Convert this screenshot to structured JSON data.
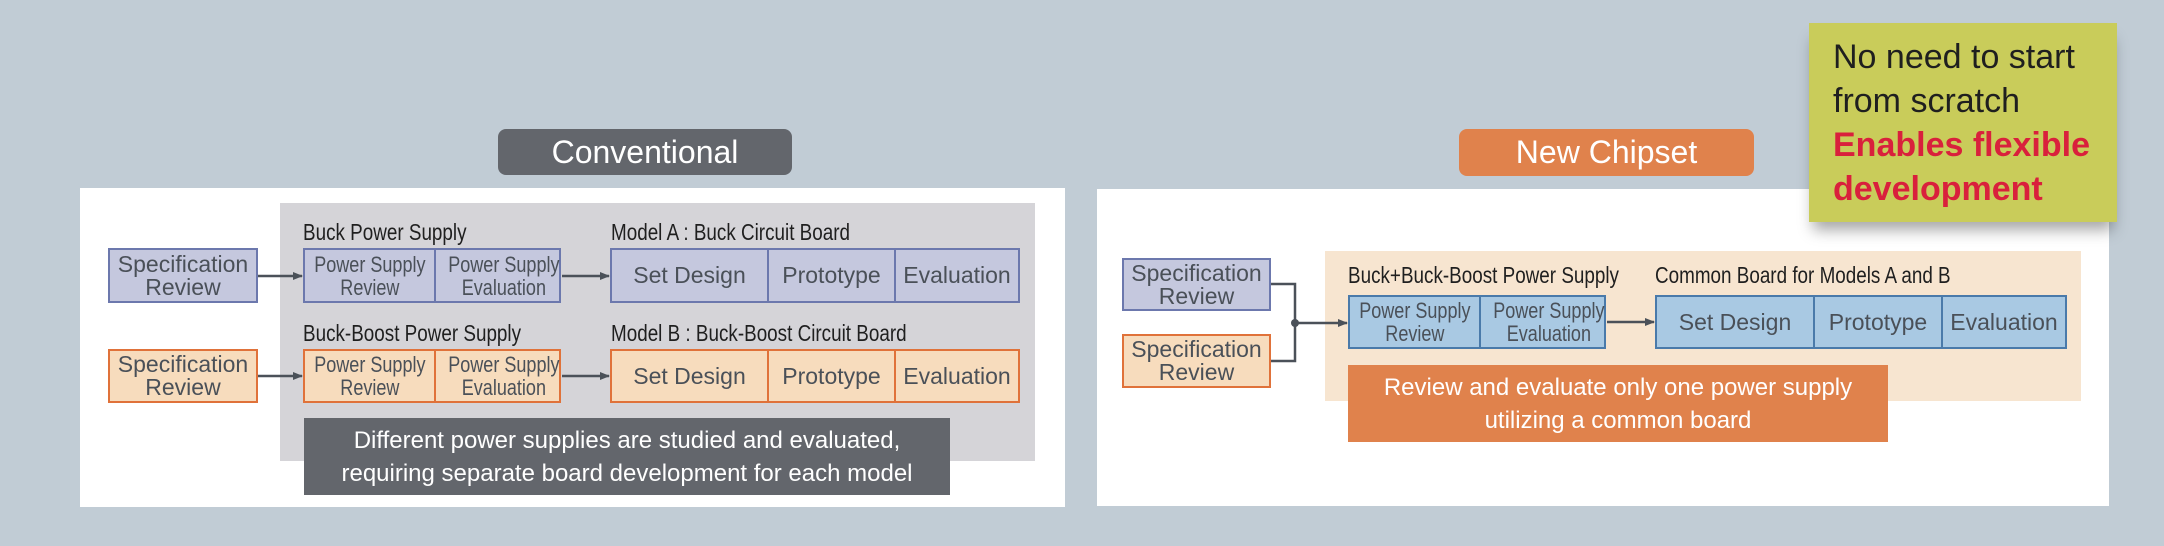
{
  "conventional": {
    "title": "Conventional",
    "rows": [
      {
        "spec": [
          "Specification",
          "Review"
        ],
        "ps_label": "Buck Power Supply",
        "ps_cells": [
          [
            "Power Supply",
            "Review"
          ],
          [
            "Power Supply",
            "Evaluation"
          ]
        ],
        "board_label": "Model A : Buck Circuit Board",
        "board_cells": [
          "Set Design",
          "Prototype",
          "Evaluation"
        ]
      },
      {
        "spec": [
          "Specification",
          "Review"
        ],
        "ps_label": "Buck-Boost Power Supply",
        "ps_cells": [
          [
            "Power Supply",
            "Review"
          ],
          [
            "Power Supply",
            "Evaluation"
          ]
        ],
        "board_label": "Model B : Buck-Boost Circuit Board",
        "board_cells": [
          "Set Design",
          "Prototype",
          "Evaluation"
        ]
      }
    ],
    "note": [
      "Different power supplies are studied and evaluated,",
      "requiring separate board development for each model"
    ]
  },
  "new_chipset": {
    "title": "New Chipset",
    "specs": [
      [
        "Specification",
        "Review"
      ],
      [
        "Specification",
        "Review"
      ]
    ],
    "ps_label": "Buck+Buck-Boost Power Supply",
    "ps_cells": [
      [
        "Power Supply",
        "Review"
      ],
      [
        "Power Supply",
        "Evaluation"
      ]
    ],
    "board_label": "Common Board for Models A and B",
    "board_cells": [
      "Set Design",
      "Prototype",
      "Evaluation"
    ],
    "note": [
      "Review and evaluate only one power supply",
      "utilizing a common board"
    ]
  },
  "highlight": {
    "lines": [
      "No need to start",
      "from scratch"
    ],
    "emphasis": [
      "Enables flexible",
      "development"
    ]
  },
  "colors": {
    "background": "#c1ccd5",
    "conventional": "#63666c",
    "new_chipset": "#e0824c",
    "highlight_bg": "#c9cc5a",
    "emphasis_text": "#d9203c",
    "buck": "#c5c8de",
    "buck_boost": "#f7dcbd",
    "common": "#a9c9e3"
  }
}
